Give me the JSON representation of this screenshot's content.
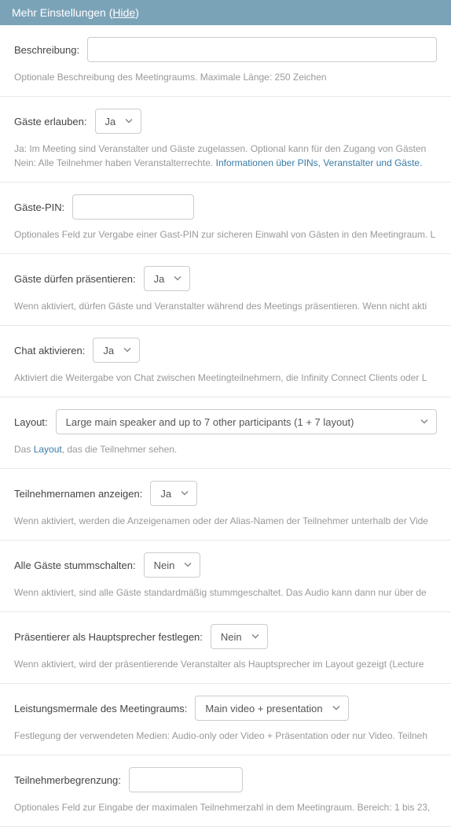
{
  "header": {
    "title_prefix": "Mehr Einstellungen (",
    "hide": "Hide",
    "title_suffix": ")"
  },
  "options": {
    "ja": "Ja",
    "nein": "Nein"
  },
  "description": {
    "label": "Beschreibung:",
    "help": "Optionale Beschreibung des Meetingraums. Maximale Länge: 250 Zeichen"
  },
  "allow_guests": {
    "label": "Gäste erlauben:",
    "value": "Ja",
    "help_line1": "Ja: Im Meeting sind Veranstalter und Gäste zugelassen. Optional kann für den Zugang von Gästen",
    "help_line2_a": "Nein: Alle Teilnehmer haben Veranstalterrechte. ",
    "help_line2_link": "Informationen über PINs, Veranstalter und Gäste."
  },
  "guest_pin": {
    "label": "Gäste-PIN:",
    "help": "Optionales Feld zur Vergabe einer Gast-PIN zur sicheren Einwahl von Gästen in den Meetingraum. L"
  },
  "guests_present": {
    "label": "Gäste dürfen präsentieren:",
    "value": "Ja",
    "help": "Wenn aktiviert, dürfen Gäste und Veranstalter während des Meetings präsentieren. Wenn nicht akti"
  },
  "chat": {
    "label": "Chat aktivieren:",
    "value": "Ja",
    "help": "Aktiviert die Weitergabe von Chat zwischen Meetingteilnehmern, die Infinity Connect Clients oder L"
  },
  "layout": {
    "label": "Layout:",
    "value": "Large main speaker and up to 7 other participants (1 + 7 layout)",
    "help_a": "Das ",
    "help_link": "Layout",
    "help_b": ", das die Teilnehmer sehen."
  },
  "show_names": {
    "label": "Teilnehmernamen anzeigen:",
    "value": "Ja",
    "help": "Wenn aktiviert, werden die Anzeigenamen oder der Alias-Namen der Teilnehmer unterhalb der Vide"
  },
  "mute_guests": {
    "label": "Alle Gäste stummschalten:",
    "value": "Nein",
    "help": "Wenn aktiviert, sind alle Gäste standardmäßig stummgeschaltet. Das Audio kann dann nur über de"
  },
  "presenter_main": {
    "label": "Präsentierer als Hauptsprecher festlegen:",
    "value": "Nein",
    "help": "Wenn aktiviert, wird der präsentierende Veranstalter als Hauptsprecher im Layout gezeigt (Lecture"
  },
  "capabilities": {
    "label": "Leistungsmermale des Meetingraums:",
    "value": "Main video + presentation",
    "help": "Festlegung der verwendeten Medien: Audio-only oder Video + Präsentation oder nur Video. Teilneh"
  },
  "limit": {
    "label": "Teilnehmerbegrenzung:",
    "help": "Optionales Feld zur Eingabe der maximalen Teilnehmerzahl in dem Meetingraum. Bereich: 1 bis 23,"
  }
}
